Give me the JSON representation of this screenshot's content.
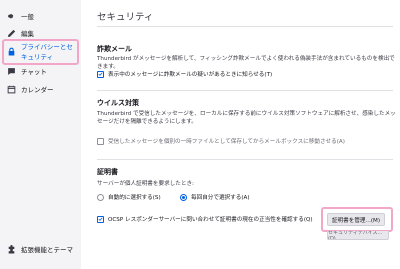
{
  "sidebar": {
    "items": [
      {
        "label": "一般",
        "icon": "gear-icon"
      },
      {
        "label": "編集",
        "icon": "pencil-icon"
      },
      {
        "label": "プライバシーとセキュリティ",
        "icon": "lock-icon",
        "active": true
      },
      {
        "label": "チャット",
        "icon": "chat-icon"
      },
      {
        "label": "カレンダー",
        "icon": "calendar-icon"
      }
    ],
    "footer_label": "拡張機能とテーマ",
    "footer_icon": "puzzle-icon"
  },
  "main": {
    "title": "セキュリティ",
    "scam": {
      "heading": "詐欺メール",
      "description": "Thunderbird がメッセージを解析して、フィッシング詐欺メールでよく使われる偽装手法が含まれているものを検出できます。",
      "checkbox_label": "表示中のメッセージに詐欺メールの疑いがあるときに知らせる(T)",
      "checkbox_checked": true
    },
    "antivirus": {
      "heading": "ウイルス対策",
      "description": "Thunderbird で受信したメッセージを、ローカルに保存する前にウイルス対策ソフトウェアに解析させ、感染したメッセージだけを隔離できるようにします。",
      "checkbox_label": "受信したメッセージを個別の一時ファイルとして保存してからメールボックスに移動させる(A)",
      "checkbox_checked": false
    },
    "certificates": {
      "heading": "証明書",
      "question": "サーバーが個人証明書を要求したとき:",
      "radio_auto": "自動的に選択する(S)",
      "radio_ask": "毎回自分で選択する(A)",
      "selected": "ask",
      "ocsp_label": "OCSP レスポンダーサーバーに問い合わせて証明書の現在の正当性を確認する(Q)",
      "ocsp_checked": true,
      "manage_button": "証明書を管理...(M)",
      "devices_button": "セキュリティデバイス...(D)"
    }
  },
  "colors": {
    "accent": "#0061e0",
    "highlight": "#f2a6c8",
    "sidebar_bg": "#f4f4f6"
  }
}
